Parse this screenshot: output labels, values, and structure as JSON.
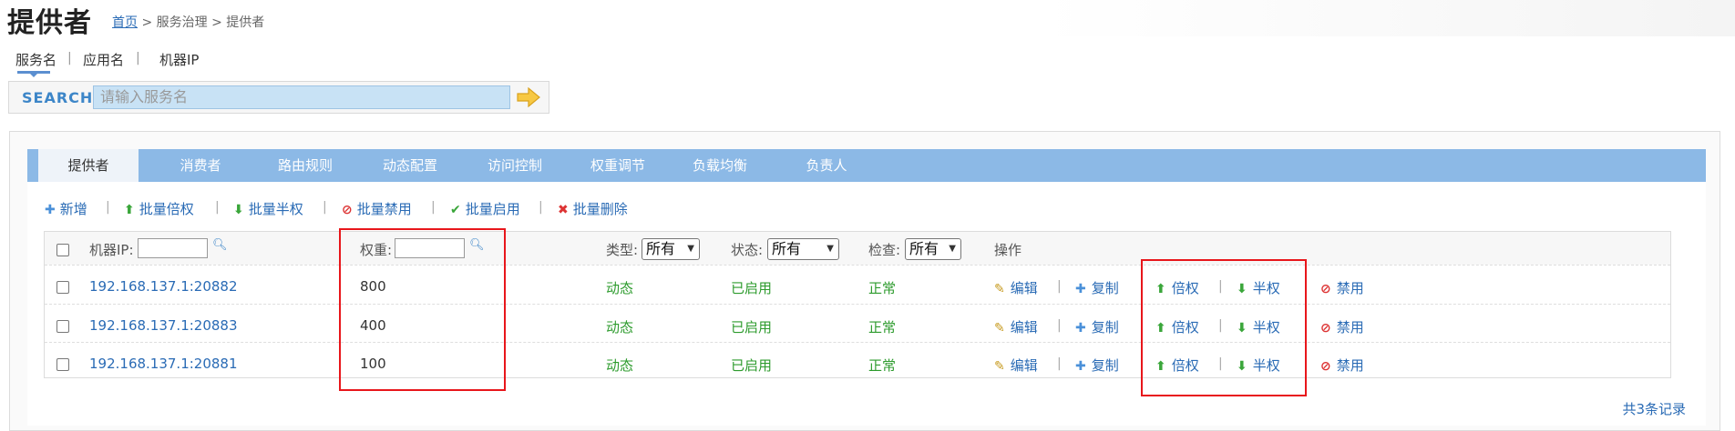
{
  "header": {
    "title": "提供者",
    "breadcrumb": {
      "home": "首页",
      "rest": " > 服务治理 > 提供者"
    }
  },
  "search_types": [
    "服务名",
    "应用名",
    "机器IP"
  ],
  "search": {
    "label": "SEARCH",
    "placeholder": "请输入服务名"
  },
  "tabs": [
    "提供者",
    "消费者",
    "路由规则",
    "动态配置",
    "访问控制",
    "权重调节",
    "负载均衡",
    "负责人"
  ],
  "toolbar": {
    "add": "新增",
    "batch_double": "批量倍权",
    "batch_half": "批量半权",
    "batch_disable": "批量禁用",
    "batch_enable": "批量启用",
    "batch_delete": "批量删除"
  },
  "table": {
    "headers": {
      "ip": "机器IP:",
      "weight": "权重:",
      "type": "类型:",
      "status": "状态:",
      "check": "检查:",
      "ops": "操作"
    },
    "filters": {
      "type": "所有",
      "status": "所有",
      "check": "所有"
    },
    "rows": [
      {
        "ip": "192.168.137.1:20882",
        "weight": "800",
        "type": "动态",
        "status": "已启用",
        "check": "正常"
      },
      {
        "ip": "192.168.137.1:20883",
        "weight": "400",
        "type": "动态",
        "status": "已启用",
        "check": "正常"
      },
      {
        "ip": "192.168.137.1:20881",
        "weight": "100",
        "type": "动态",
        "status": "已启用",
        "check": "正常"
      }
    ],
    "ops": {
      "edit": "编辑",
      "copy": "复制",
      "double": "倍权",
      "half": "半权",
      "disable": "禁用"
    }
  },
  "footer": {
    "count": "共3条记录"
  },
  "colors": {
    "accent": "#3d86c8",
    "tab_bar": "#8cb9e6",
    "highlight": "#e8161b",
    "enabled": "#2d9b2d"
  }
}
